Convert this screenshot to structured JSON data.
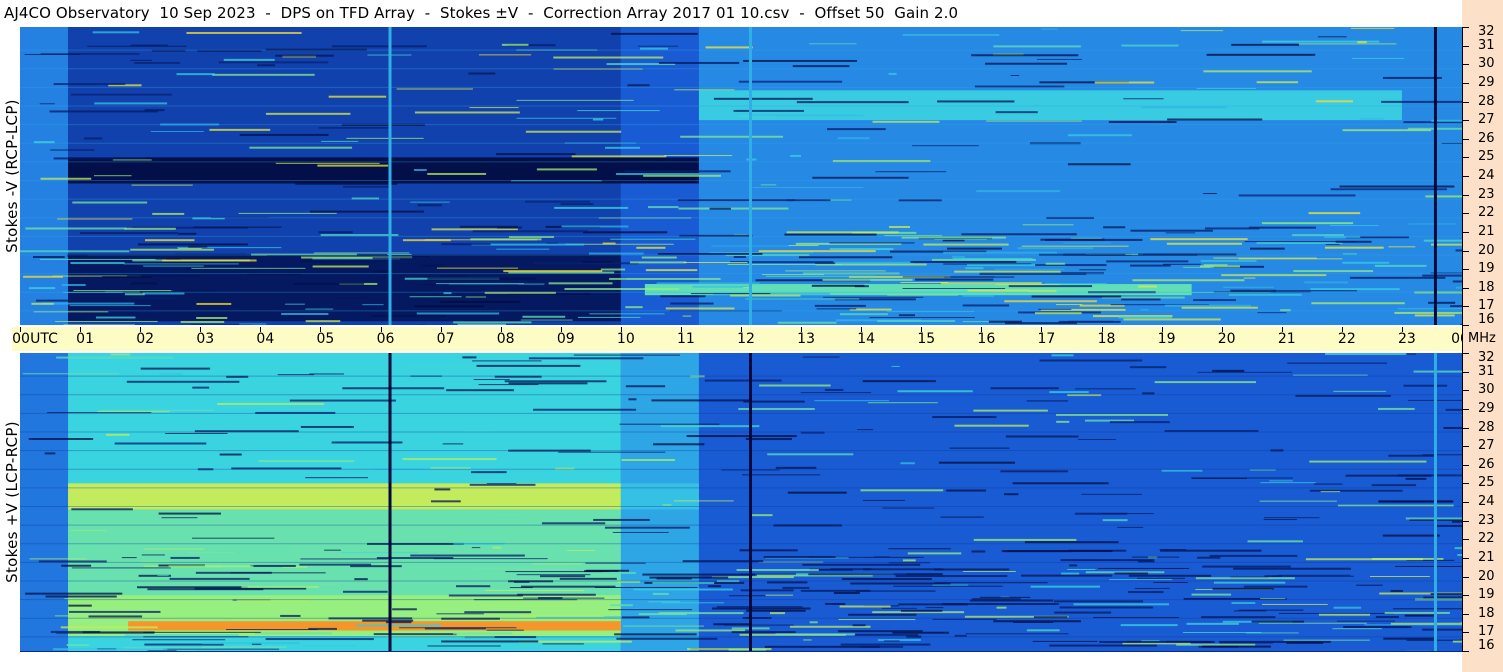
{
  "title": "AJ4CO Observatory  10 Sep 2023  -  DPS on TFD Array  -  Stokes ±V  -  Correction Array 2017 01 10.csv  -  Offset 50  Gain 2.0",
  "colors": {
    "axis_strip_bg": "#fdfcc4",
    "freq_strip_bg": "#fce0c8",
    "colormap": [
      "#000a3c",
      "#0a2a8a",
      "#1a5fd8",
      "#2b9ae8",
      "#3ad4e0",
      "#9af07a",
      "#f5e83a",
      "#f59a2a",
      "#f03a7a"
    ]
  },
  "chart_data": [
    {
      "type": "heatmap",
      "panel": "top",
      "ylabel": "Stokes -V (RCP-LCP)",
      "x_unit": "UTC",
      "x_ticks": [
        "00",
        "01",
        "02",
        "03",
        "04",
        "05",
        "06",
        "07",
        "08",
        "09",
        "10",
        "11",
        "12",
        "13",
        "14",
        "15",
        "16",
        "17",
        "18",
        "19",
        "20",
        "21",
        "22",
        "23",
        "00"
      ],
      "y_unit": "MHz",
      "y_range": [
        16,
        32
      ],
      "y_ticks": [
        "32",
        "31",
        "30",
        "29",
        "28",
        "27",
        "26",
        "25",
        "24",
        "23",
        "22",
        "21",
        "20",
        "19",
        "18",
        "17",
        "16"
      ],
      "regions": [
        {
          "x": [
            0,
            0.8
          ],
          "level": 0.32
        },
        {
          "x": [
            0.8,
            10.0
          ],
          "level": 0.18
        },
        {
          "x": [
            10.0,
            11.3
          ],
          "level": 0.24
        },
        {
          "x": [
            11.3,
            24
          ],
          "level": 0.34
        }
      ],
      "bands": [
        {
          "x": [
            0.8,
            11.3
          ],
          "y": [
            23.6,
            25.0
          ],
          "level": 0.02
        },
        {
          "x": [
            0.8,
            10.0
          ],
          "y": [
            16.2,
            19.8
          ],
          "level": 0.06
        },
        {
          "x": [
            11.3,
            23.0
          ],
          "y": [
            27.0,
            28.6
          ],
          "level": 0.48
        },
        {
          "x": [
            10.4,
            19.5
          ],
          "y": [
            17.6,
            18.2
          ],
          "level": 0.55
        }
      ],
      "vlines": [
        {
          "x": 6.15,
          "level": 0.42
        },
        {
          "x": 12.15,
          "level": 0.42
        },
        {
          "x": 23.55,
          "level": 0.0
        }
      ]
    },
    {
      "type": "heatmap",
      "panel": "bottom",
      "ylabel": "Stokes +V (LCP-RCP)",
      "x_unit": "UTC",
      "x_ticks": [
        "00",
        "01",
        "02",
        "03",
        "04",
        "05",
        "06",
        "07",
        "08",
        "09",
        "10",
        "11",
        "12",
        "13",
        "14",
        "15",
        "16",
        "17",
        "18",
        "19",
        "20",
        "21",
        "22",
        "23",
        "00"
      ],
      "y_unit": "MHz",
      "y_range": [
        16,
        32
      ],
      "y_ticks": [
        "32",
        "31",
        "30",
        "29",
        "28",
        "27",
        "26",
        "25",
        "24",
        "23",
        "22",
        "21",
        "20",
        "19",
        "18",
        "17",
        "16"
      ],
      "regions": [
        {
          "x": [
            0,
            0.8
          ],
          "level": 0.3
        },
        {
          "x": [
            0.8,
            10.0
          ],
          "level": 0.5
        },
        {
          "x": [
            10.0,
            11.3
          ],
          "level": 0.4
        },
        {
          "x": [
            11.3,
            24
          ],
          "level": 0.24
        }
      ],
      "bands": [
        {
          "x": [
            0.8,
            10.0
          ],
          "y": [
            23.6,
            25.0
          ],
          "level": 0.68
        },
        {
          "x": [
            0.8,
            10.0
          ],
          "y": [
            19.0,
            23.6
          ],
          "level": 0.56
        },
        {
          "x": [
            0.8,
            10.0
          ],
          "y": [
            16.8,
            19.0
          ],
          "level": 0.62
        },
        {
          "x": [
            1.8,
            10.0
          ],
          "y": [
            17.1,
            17.6
          ],
          "level": 0.88
        },
        {
          "x": [
            10.0,
            11.3
          ],
          "y": [
            23.6,
            25.0
          ],
          "level": 0.46
        }
      ],
      "vlines": [
        {
          "x": 6.15,
          "level": 0.0
        },
        {
          "x": 12.15,
          "level": 0.0
        },
        {
          "x": 23.55,
          "level": 0.42
        }
      ]
    }
  ]
}
